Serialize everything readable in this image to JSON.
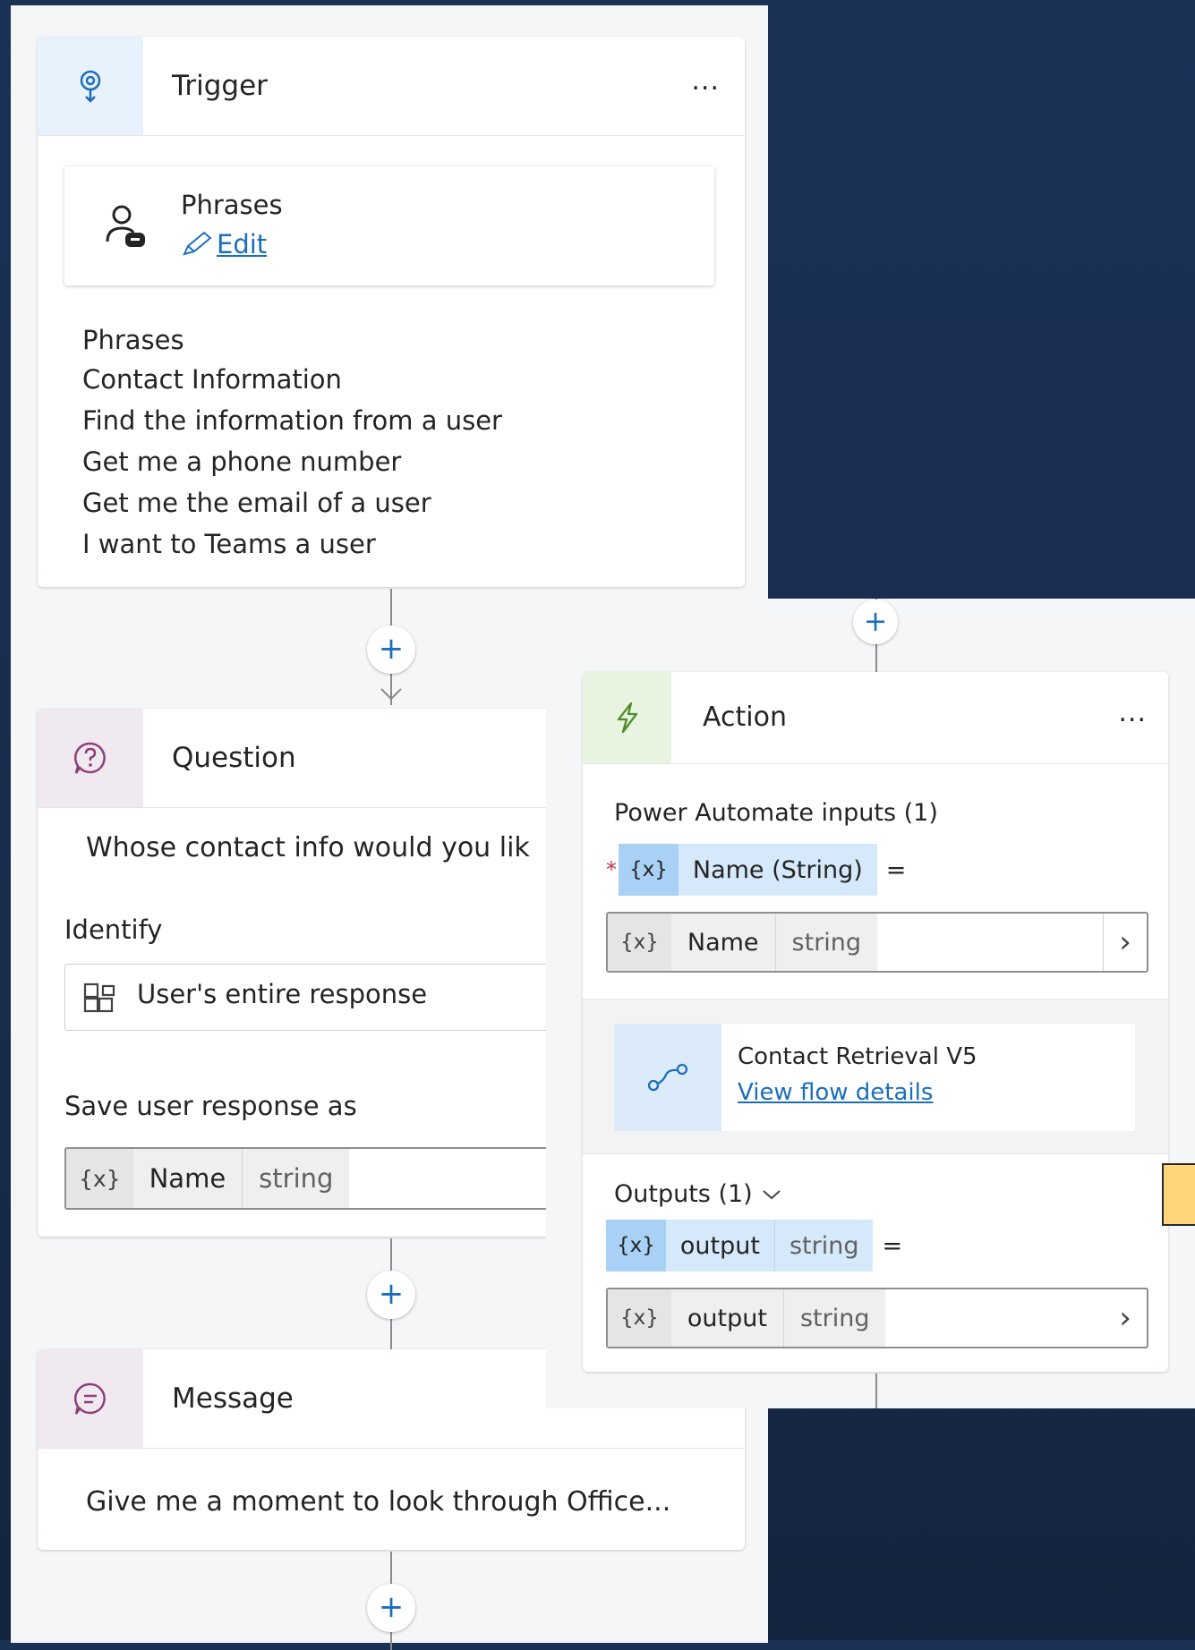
{
  "trigger": {
    "title": "Trigger",
    "more": "...",
    "phrases_label": "Phrases",
    "edit_label": "Edit",
    "phrases_heading": "Phrases",
    "phrases": [
      "Contact Information",
      "Find the information from a user",
      "Get me a phone number",
      "Get me the email of a user",
      "I want to Teams a user"
    ]
  },
  "question": {
    "title": "Question",
    "prompt": "Whose contact info would you lik",
    "identify_label": "Identify",
    "identify_value": "User's entire response",
    "save_label": "Save user response as",
    "var_x": "{x}",
    "var_name": "Name",
    "var_type": "string"
  },
  "message": {
    "title": "Message",
    "text": "Give me a moment to look through Office..."
  },
  "action": {
    "title": "Action",
    "more": "...",
    "inputs_label": "Power Automate inputs (1)",
    "required_mark": "*",
    "input_x": "{x}",
    "input_param": "Name (String)",
    "equals": "=",
    "input_var_x": "{x}",
    "input_var_name": "Name",
    "input_var_type": "string",
    "flow_name": "Contact Retrieval V5",
    "flow_link": "View flow details",
    "outputs_label": "Outputs (1)",
    "output_x": "{x}",
    "output_param": "output",
    "output_type": "string",
    "output_equals": "=",
    "output_var_x": "{x}",
    "output_var_name": "output",
    "output_var_type": "string"
  },
  "connector": {
    "plus": "+"
  },
  "colors": {
    "background": "#1b3156",
    "trigger_icon_bg": "#e8f2fc",
    "question_icon_bg": "#f1e9f0",
    "action_icon_bg": "#e8f4e0",
    "link": "#1b6fb8",
    "sticky": "#ffd77a"
  }
}
